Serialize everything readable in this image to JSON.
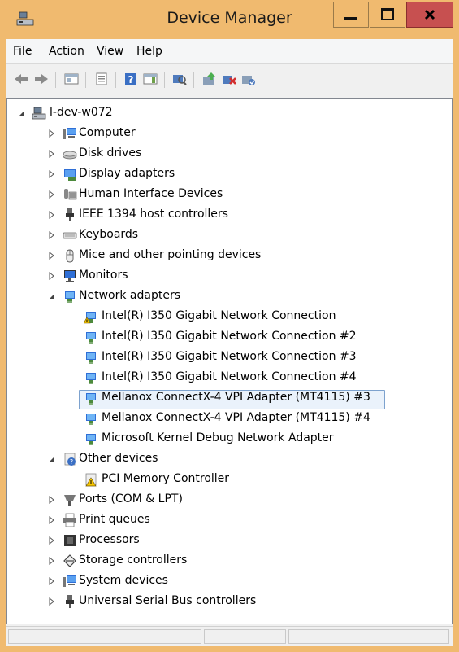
{
  "window": {
    "title": "Device Manager"
  },
  "menu": [
    "File",
    "Action",
    "View",
    "Help"
  ],
  "toolbar": [
    "back-icon",
    "forward-icon",
    "show-hide-console-tree-icon",
    "properties-icon",
    "help-icon",
    "show-action-pane-icon",
    "scan-hardware-icon",
    "update-driver-icon",
    "uninstall-icon",
    "enable-device-icon"
  ],
  "tree": {
    "root": "l-dev-w072",
    "categories": [
      {
        "label": "Computer",
        "icon": "computer-icon",
        "expanded": false
      },
      {
        "label": "Disk drives",
        "icon": "disk-drive-icon",
        "expanded": false
      },
      {
        "label": "Display adapters",
        "icon": "display-adapter-icon",
        "expanded": false
      },
      {
        "label": "Human Interface Devices",
        "icon": "hid-icon",
        "expanded": false
      },
      {
        "label": "IEEE 1394 host controllers",
        "icon": "ieee1394-icon",
        "expanded": false
      },
      {
        "label": "Keyboards",
        "icon": "keyboard-icon",
        "expanded": false
      },
      {
        "label": "Mice and other pointing devices",
        "icon": "mouse-icon",
        "expanded": false
      },
      {
        "label": "Monitors",
        "icon": "monitor-icon",
        "expanded": false
      },
      {
        "label": "Network adapters",
        "icon": "network-adapter-icon",
        "expanded": true,
        "children": [
          {
            "label": "Intel(R) I350 Gigabit Network Connection",
            "icon": "network-adapter-warning-icon"
          },
          {
            "label": "Intel(R) I350 Gigabit Network Connection #2",
            "icon": "network-adapter-icon"
          },
          {
            "label": "Intel(R) I350 Gigabit Network Connection #3",
            "icon": "network-adapter-icon"
          },
          {
            "label": "Intel(R) I350 Gigabit Network Connection #4",
            "icon": "network-adapter-icon"
          },
          {
            "label": "Mellanox ConnectX-4 VPI Adapter (MT4115) #3",
            "icon": "network-adapter-icon",
            "selected": true
          },
          {
            "label": "Mellanox ConnectX-4 VPI Adapter (MT4115) #4",
            "icon": "network-adapter-icon"
          },
          {
            "label": "Microsoft Kernel Debug Network Adapter",
            "icon": "network-adapter-icon"
          }
        ]
      },
      {
        "label": "Other devices",
        "icon": "other-devices-icon",
        "expanded": true,
        "children": [
          {
            "label": "PCI Memory Controller",
            "icon": "unknown-device-warning-icon"
          }
        ]
      },
      {
        "label": "Ports (COM & LPT)",
        "icon": "port-icon",
        "expanded": false
      },
      {
        "label": "Print queues",
        "icon": "printer-icon",
        "expanded": false
      },
      {
        "label": "Processors",
        "icon": "processor-icon",
        "expanded": false
      },
      {
        "label": "Storage controllers",
        "icon": "storage-controller-icon",
        "expanded": false
      },
      {
        "label": "System devices",
        "icon": "system-devices-icon",
        "expanded": false
      },
      {
        "label": "Universal Serial Bus controllers",
        "icon": "usb-icon",
        "expanded": false
      }
    ]
  },
  "colors": {
    "titlebar": "#f0ba6f",
    "close": "#c75050",
    "selection_border": "#7da2ce",
    "selection_fill": "#eaf2fb"
  }
}
